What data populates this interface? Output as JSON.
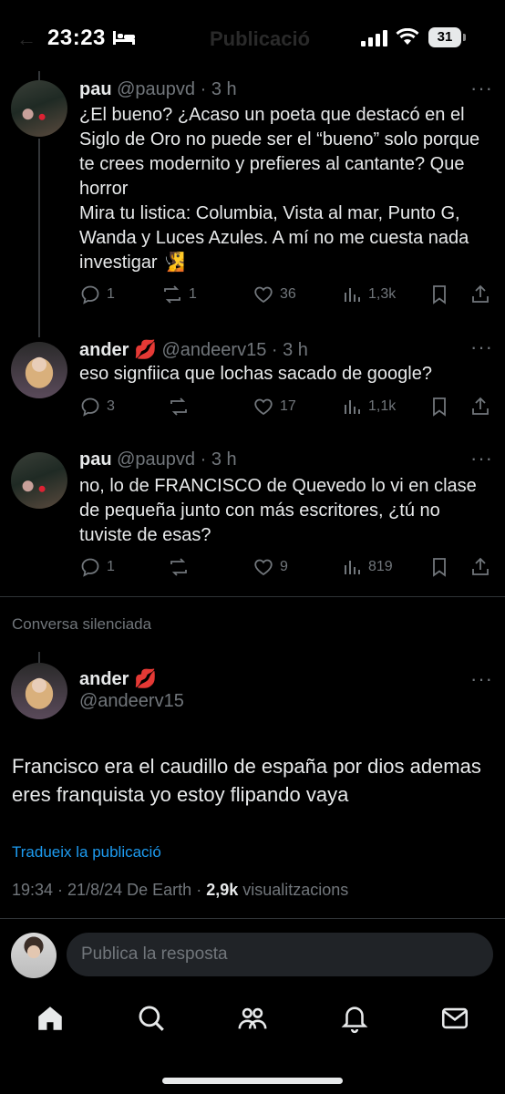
{
  "status_bar": {
    "time": "23:23",
    "battery": "31"
  },
  "header": {
    "back_glyph": "←",
    "title": "Publicació"
  },
  "replies": [
    {
      "name": "pau",
      "emoji": "",
      "handle": "@paupvd",
      "time": "3 h",
      "text": "¿El bueno? ¿Acaso un poeta que destacó en el Siglo de Oro no puede ser el “bueno” solo porque te crees modernito y prefieres al cantante? Que horror\nMira tu listica: Columbia, Vista al mar, Punto G, Wanda y Luces Azules. A mí no me cuesta nada investigar 🧏",
      "replies": "1",
      "reposts": "1",
      "likes": "36",
      "views": "1,3k"
    },
    {
      "name": "ander",
      "emoji": "💋",
      "handle": "@andeerv15",
      "time": "3 h",
      "text": "eso signfiica que lochas sacado de google?",
      "replies": "3",
      "reposts": "",
      "likes": "17",
      "views": "1,1k"
    },
    {
      "name": "pau",
      "emoji": "",
      "handle": "@paupvd",
      "time": "3 h",
      "text": "no, lo de FRANCISCO de Quevedo lo vi en clase de pequeña junto con más escritores, ¿tú no tuviste de esas?",
      "replies": "1",
      "reposts": "",
      "likes": "9",
      "views": "819"
    }
  ],
  "muted_label": "Conversa silenciada",
  "main_post": {
    "name": "ander",
    "emoji": "💋",
    "handle": "@andeerv15",
    "text": "Francisco era el caudillo de españa por dios ademas eres franquista yo estoy flipando vaya",
    "translate": "Tradueix la publicació",
    "datetime": "19:34 · 21/8/24",
    "source": "De Earth",
    "views_count": "2,9k",
    "views_label": "visualitzacions"
  },
  "reply_bar": {
    "placeholder": "Publica la resposta"
  },
  "tabs": [
    "home",
    "search",
    "communities",
    "notifications",
    "messages"
  ],
  "colors": {
    "accent": "#1d9bf0",
    "muted": "#71767b",
    "background": "#000000"
  }
}
